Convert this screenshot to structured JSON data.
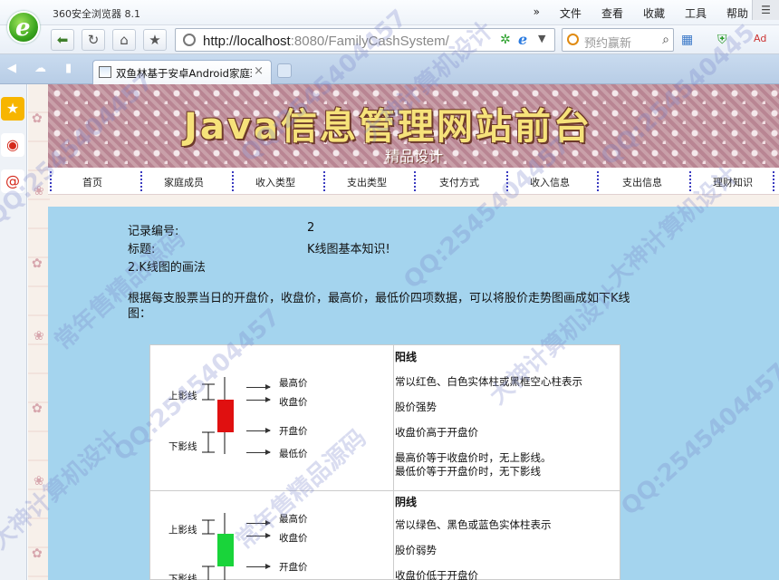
{
  "browser": {
    "title": "360安全浏览器 8.1",
    "menu": [
      "»",
      "文件",
      "查看",
      "收藏",
      "工具",
      "帮助"
    ],
    "url_host": "http://localhost",
    "url_rest": ":8080/FamilyCashSystem/",
    "search_placeholder": "预约赢新",
    "tab_label": "双鱼林基于安卓Android家庭理财",
    "tab_close": "×"
  },
  "site": {
    "banner_title": "Java信息管理网站前台",
    "banner_subtitle": "精品设计",
    "nav": [
      "首页",
      "家庭成员",
      "收入类型",
      "支出类型",
      "支付方式",
      "收入信息",
      "支出信息",
      "理财知识"
    ]
  },
  "record": {
    "id_label": "记录编号:",
    "id_value": "2",
    "title_label": "标题:",
    "title_value": "K线图基本知识!",
    "section": "2.K线图的画法",
    "paragraph_l1": "根据每支股票当日的开盘价，收盘价，最高价，最低价四项数据，可以将股价走势图画成如下K线",
    "paragraph_l2": "图："
  },
  "kline": {
    "yang": {
      "upper_shadow": "上影线",
      "lower_shadow": "下影线",
      "labels": [
        "最高价",
        "收盘价",
        "开盘价",
        "最低价"
      ],
      "heading": "阳线",
      "desc": [
        "常以红色、白色实体柱或黑框空心柱表示",
        "股价强势",
        "收盘价高于开盘价",
        "最高价等于收盘价时，无上影线。",
        "最低价等于开盘价时，无下影线"
      ],
      "color": "#e01010"
    },
    "yin": {
      "upper_shadow": "上影线",
      "lower_shadow": "下影线",
      "labels": [
        "最高价",
        "收盘价",
        "开盘价"
      ],
      "heading": "阴线",
      "desc": [
        "常以绿色、黑色或蓝色实体柱表示",
        "股价弱势",
        "收盘价低于开盘价"
      ],
      "color": "#19d43a"
    }
  },
  "watermarks": [
    "QQ:2545404457",
    "大神计算机设计",
    "常年售精品源码",
    "QQ:2545404457",
    "QQ:2545404457",
    "大神计算机设计",
    "常年售精品源码",
    "QQ:2545404457",
    "大神计算机设计",
    "QQ:254540445",
    "QQ:2545404457",
    "大神计算机设计"
  ]
}
